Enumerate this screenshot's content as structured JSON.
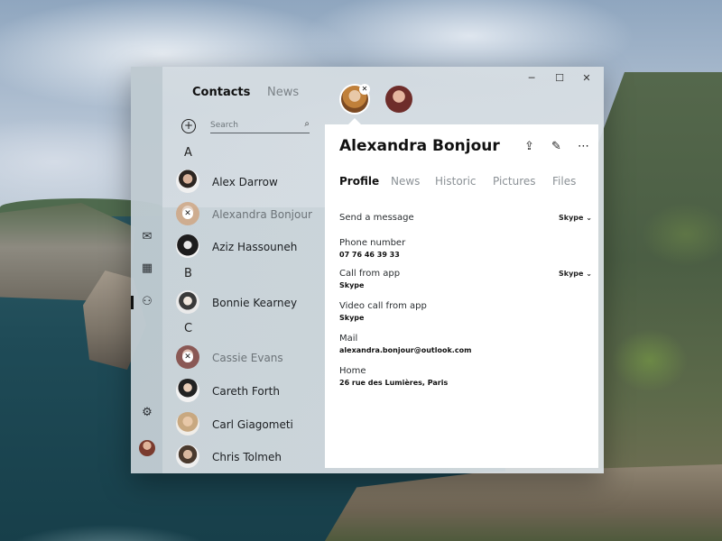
{
  "window": {
    "controls": {
      "minimize": "─",
      "maximize": "☐",
      "close": "✕"
    }
  },
  "rail": {
    "icons": [
      "mail-icon",
      "calendar-icon",
      "people-icon",
      "settings-icon"
    ],
    "glyphs": {
      "mail": "✉",
      "calendar": "▦",
      "people": "⚇",
      "settings": "⚙"
    }
  },
  "list": {
    "tabs": {
      "contacts": "Contacts",
      "news": "News"
    },
    "add_glyph": "+",
    "search": {
      "placeholder": "Search",
      "glyph": "⌕"
    },
    "groups": [
      {
        "letter": "A"
      },
      {
        "letter": "B"
      },
      {
        "letter": "C"
      }
    ],
    "contacts": [
      {
        "name": "Alex Darrow",
        "selected": false
      },
      {
        "name": "Alexandra Bonjour",
        "selected": true
      },
      {
        "name": "Aziz Hassouneh",
        "selected": false
      },
      {
        "name": "Bonnie Kearney",
        "selected": false
      },
      {
        "name": "Cassie Evans",
        "selected": true
      },
      {
        "name": "Careth Forth",
        "selected": false
      },
      {
        "name": "Carl Giagometi",
        "selected": false
      },
      {
        "name": "Chris Tolmeh",
        "selected": false
      }
    ],
    "badge_glyph": "✕"
  },
  "top_strip": {
    "close_glyph": "✕"
  },
  "detail": {
    "name": "Alexandra Bonjour",
    "actions": {
      "share": "⇪",
      "edit": "✎",
      "more": "⋯"
    },
    "tabs": [
      "Profile",
      "News",
      "Historic",
      "Pictures",
      "Files"
    ],
    "active_tab": "Profile",
    "fields": [
      {
        "label": "Send a message",
        "value": "",
        "service": "Skype ⌄"
      },
      {
        "label": "Phone number",
        "value": "07 76 46 39 33",
        "service": ""
      },
      {
        "label": "Call from app",
        "value": "Skype",
        "service": "Skype ⌄"
      },
      {
        "label": "Video call from app",
        "value": "Skype",
        "service": ""
      },
      {
        "label": "Mail",
        "value": "alexandra.bonjour@outlook.com",
        "service": ""
      },
      {
        "label": "Home",
        "value": "26 rue des Lumières, Paris",
        "service": ""
      }
    ]
  },
  "colors": {
    "accent": "#111111",
    "muted": "#7b8287"
  }
}
